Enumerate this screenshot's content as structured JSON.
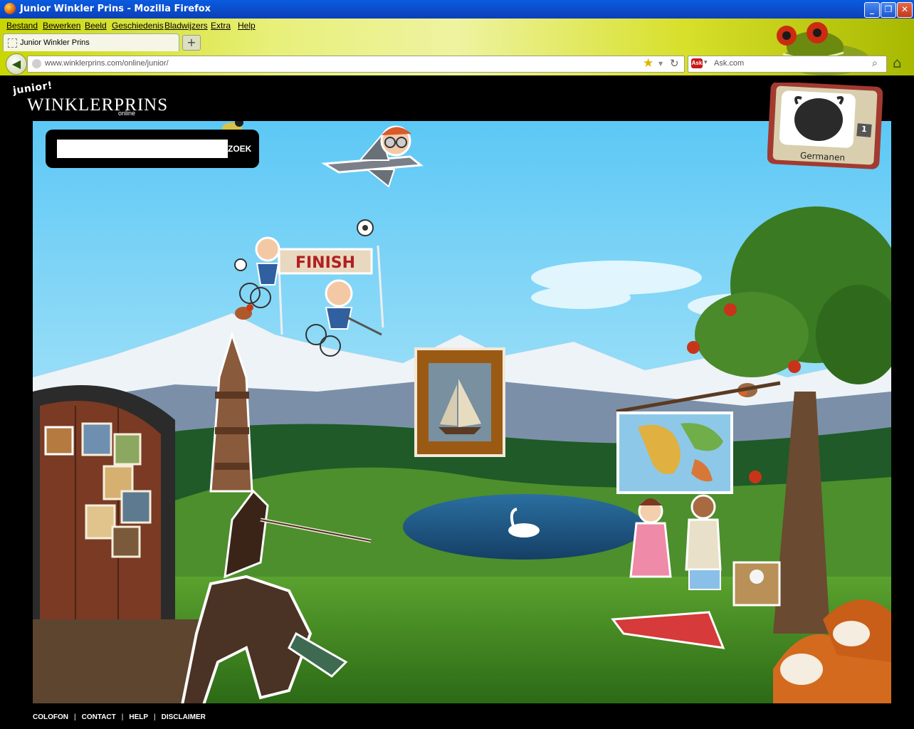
{
  "window": {
    "title": "Junior Winkler Prins - Mozilla Firefox"
  },
  "menu": [
    "Bestand",
    "Bewerken",
    "Beeld",
    "Geschiedenis",
    "Bladwijzers",
    "Extra",
    "Help"
  ],
  "tab": {
    "label": "Junior Winkler Prins",
    "new_tab_glyph": "+"
  },
  "address": {
    "url": "www.winklerprins.com/online/junior/"
  },
  "search_engine": {
    "placeholder": "Ask.com"
  },
  "site": {
    "logo_junior": "junior!",
    "logo_main": "WINKLERPRINS",
    "logo_sub": "online",
    "search_button": "ZOEK",
    "search_value": "",
    "tv_label": "Germanen",
    "tv_number": "1",
    "finish_banner": "FINISH"
  },
  "footer": {
    "links": [
      "COLOFON",
      "CONTACT",
      "HELP",
      "DISCLAIMER"
    ]
  },
  "icons": [
    "firefox-icon",
    "back-icon",
    "globe-icon",
    "star-icon",
    "reload-icon",
    "ask-icon",
    "search-icon",
    "home-icon",
    "minimize-icon",
    "restore-icon",
    "close-icon"
  ],
  "colors": {
    "titlebar": "#0c4fd0",
    "chrome": "#d7e02a",
    "sky": "#7fd4f5",
    "grass": "#3f8a22",
    "page_bg": "#000000"
  }
}
